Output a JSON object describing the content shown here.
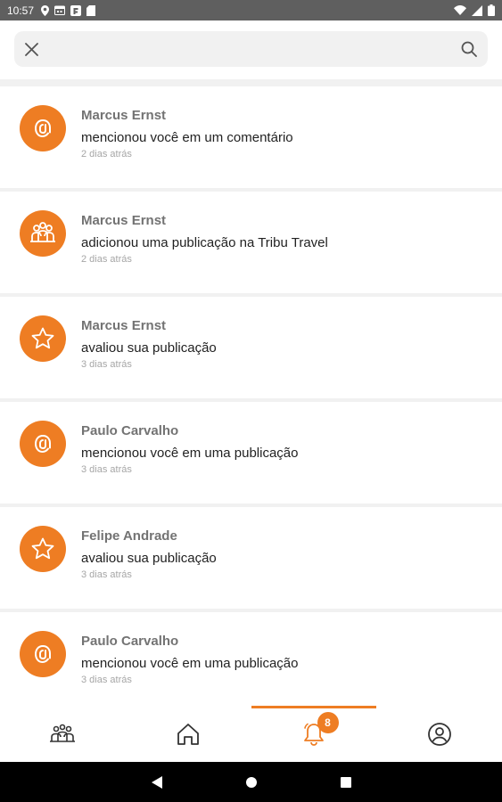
{
  "status_bar": {
    "time": "10:57"
  },
  "search": {
    "placeholder": "",
    "value": ""
  },
  "notifications": [
    {
      "name": "Marcus Ernst",
      "action": "mencionou você em um comentário",
      "time": "2 dias atrás",
      "icon": "at-icon"
    },
    {
      "name": "Marcus Ernst",
      "action": "adicionou uma publicação na Tribu Travel",
      "time": "2 dias atrás",
      "icon": "group-icon"
    },
    {
      "name": "Marcus Ernst",
      "action": "avaliou sua publicação",
      "time": "3 dias atrás",
      "icon": "star-icon"
    },
    {
      "name": "Paulo Carvalho",
      "action": "mencionou você em uma publicação",
      "time": "3 dias atrás",
      "icon": "at-icon"
    },
    {
      "name": "Felipe Andrade",
      "action": "avaliou sua publicação",
      "time": "3 dias atrás",
      "icon": "star-icon"
    },
    {
      "name": "Paulo Carvalho",
      "action": "mencionou você em uma publicação",
      "time": "3 dias atrás",
      "icon": "at-icon"
    }
  ],
  "bottom_nav": {
    "items": [
      "tribes-icon",
      "home-icon",
      "bell-icon",
      "profile-icon"
    ],
    "active": "bell-icon",
    "badge_count": "8"
  },
  "colors": {
    "accent": "#ee7d23",
    "status_bar": "#5f5f5f"
  }
}
